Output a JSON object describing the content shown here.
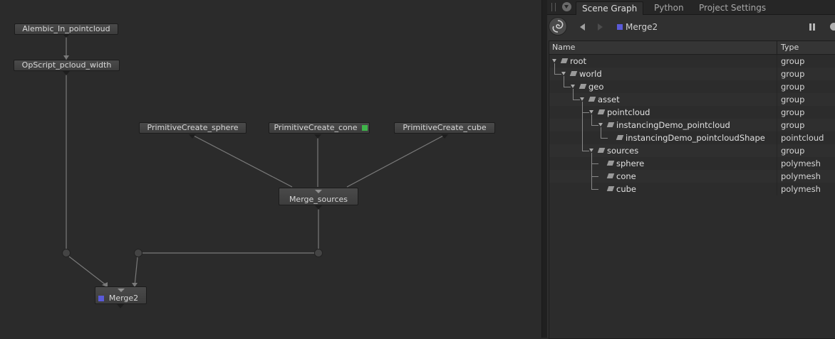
{
  "node_graph": {
    "nodes": {
      "alembic_in": "Alembic_In_pointcloud",
      "opscript": "OpScript_pcloud_width",
      "prim_sphere": "PrimitiveCreate_sphere",
      "prim_cone": "PrimitiveCreate_cone",
      "prim_cube": "PrimitiveCreate_cube",
      "merge_sources": "Merge_sources",
      "merge2": "Merge2"
    },
    "colors": {
      "background": "#2b2b2b",
      "node": "#444444",
      "wire": "#777777",
      "edited_flag": "#3fb54a",
      "view_flag": "#5a5ad8"
    }
  },
  "panel": {
    "tabs": [
      "Scene Graph",
      "Python",
      "Project Settings"
    ],
    "active_tab": "Scene Graph",
    "viewed_node": "Merge2",
    "columns": {
      "name": "Name",
      "type": "Type"
    },
    "rows": [
      {
        "name": "root",
        "type": "group",
        "depth": 0
      },
      {
        "name": "world",
        "type": "group",
        "depth": 1
      },
      {
        "name": "geo",
        "type": "group",
        "depth": 2
      },
      {
        "name": "asset",
        "type": "group",
        "depth": 3
      },
      {
        "name": "pointcloud",
        "type": "group",
        "depth": 4
      },
      {
        "name": "instancingDemo_pointcloud",
        "type": "group",
        "depth": 5
      },
      {
        "name": "instancingDemo_pointcloudShape",
        "type": "pointcloud",
        "depth": 6
      },
      {
        "name": "sources",
        "type": "group",
        "depth": 4
      },
      {
        "name": "sphere",
        "type": "polymesh",
        "depth": 5
      },
      {
        "name": "cone",
        "type": "polymesh",
        "depth": 5
      },
      {
        "name": "cube",
        "type": "polymesh",
        "depth": 5
      }
    ]
  }
}
